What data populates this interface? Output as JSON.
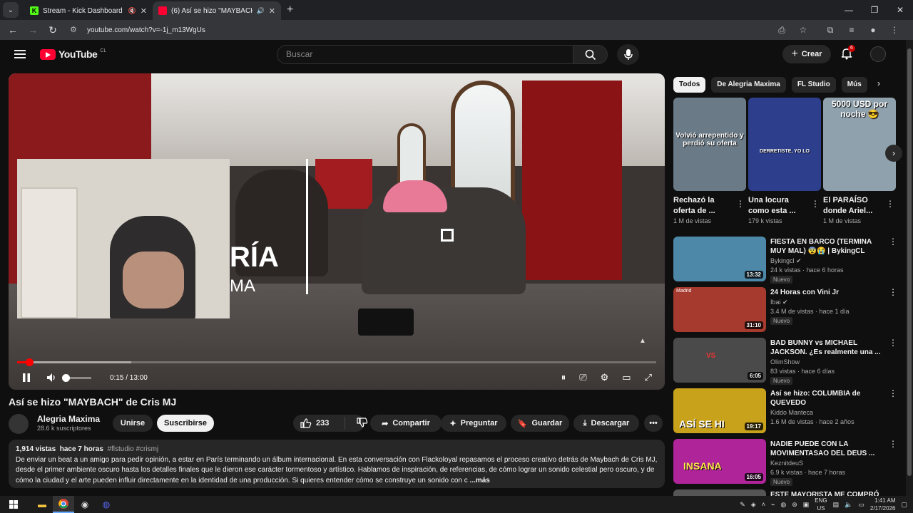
{
  "browser": {
    "tabs": [
      {
        "title": "Stream - Kick Dashboard",
        "favicon": "K",
        "favicon_color": "#53fc18"
      },
      {
        "title": "(6) Así se hizo \"MAYBACH\"",
        "favicon": "yt",
        "favicon_color": "#ff0033"
      }
    ],
    "url": "youtube.com/watch?v=-1j_m13WgUs"
  },
  "header": {
    "logo_text": "YouTube",
    "country": "CL",
    "search_placeholder": "Buscar",
    "create_label": "Crear",
    "notifications": "6"
  },
  "player": {
    "time": "0:15 / 13:00",
    "progress_fraction": 0.019,
    "volume_fraction": 0.1,
    "overlay_line1": "RÍA",
    "overlay_line2": "MA"
  },
  "video": {
    "title": "Así se hizo \"MAYBACH\" de Cris MJ",
    "channel": "Alegria Maxima",
    "subscribers": "28.6 k suscriptores",
    "join_label": "Unirse",
    "subscribe_label": "Suscribirse",
    "likes": "233",
    "share_label": "Compartir",
    "ask_label": "Preguntar",
    "save_label": "Guardar",
    "download_label": "Descargar"
  },
  "description": {
    "views": "1,914 vistas",
    "age": "hace 7 horas",
    "tags": "#flstudio #crismj",
    "text": "De enviar un beat a un amigo para pedir opinión, a estar en París terminando un álbum internacional. En esta conversación con Flackoloyal repasamos el proceso creativo detrás de Maybach de Cris MJ, desde el primer ambiente oscuro hasta los detalles finales que le dieron ese carácter tormentoso y artístico. Hablamos de inspiración, de referencias, de cómo lograr un sonido celestial pero oscuro, y de cómo la ciudad y el arte pueden influir directamente en la identidad de una producción. Si quieres entender cómo se construye un sonido con c",
    "more_label": "...más"
  },
  "chips": [
    "Todos",
    "De Alegria Maxima",
    "FL Studio",
    "Mús"
  ],
  "shorts": [
    {
      "caption": "Volvió arrepentido y perdió su oferta",
      "title": "Rechazó la oferta de ...",
      "views": "1 M de vistas",
      "color": "#6a7a86"
    },
    {
      "caption": "DERRETISTE, YO LO",
      "title": "Una locura como esta ...",
      "views": "179 k vistas",
      "color": "#2d3e8c"
    },
    {
      "caption": "5000 USD por noche 😎",
      "title": "El PARAÍSO donde Ariel...",
      "views": "1 M de vistas",
      "color": "#8fa1ad"
    }
  ],
  "videos": [
    {
      "title": "FIESTA EN BARCO (TERMINA MUY MAL) 😨😭 | BykingCL",
      "channel": "Bykingcl",
      "meta": "24 k vistas · hace 6 horas",
      "duration": "13:32",
      "badge": "Nuevo",
      "color": "#4d88a8",
      "verified": true
    },
    {
      "title": "24 Horas con Vini Jr",
      "channel": "Ibai",
      "meta": "3.4 M de vistas · hace 1 día",
      "duration": "31:10",
      "badge": "Nuevo",
      "color": "#a63a2e",
      "verified": true
    },
    {
      "title": "BAD BUNNY vs MICHAEL JACKSON. ¿Es realmente una ...",
      "channel": "OlimShow",
      "meta": "83 vistas · hace 6 días",
      "duration": "6:05",
      "badge": "Nuevo",
      "color": "#4a4a4a",
      "verified": false
    },
    {
      "title": "Así se hizo: COLUMBIA de QUEVEDO",
      "channel": "Kiddo Manteca",
      "meta": "1.6 M de vistas · hace 2 años",
      "duration": "19:17",
      "badge": "",
      "color": "#c9a21c",
      "verified": false
    },
    {
      "title": "NADIE PUEDE CON LA MOVIMENTASAO DEL DEUS ...",
      "channel": "KeznitdeuS",
      "meta": "6.9 k vistas · hace 7 horas",
      "duration": "16:05",
      "badge": "Nuevo",
      "color": "#b0249a",
      "verified": false
    },
    {
      "title": "ESTE MAYORISTA ME COMPRÓ",
      "channel": "",
      "meta": "",
      "duration": "",
      "badge": "",
      "color": "#555555",
      "verified": false
    }
  ],
  "thumb_captions": [
    "",
    "Madrid",
    "VS",
    "ASÍ SE HI",
    "INSANA",
    ""
  ],
  "taskbar": {
    "lang_top": "ENG",
    "lang_bottom": "US",
    "time": "1:41 AM",
    "date": "2/17/2026"
  }
}
